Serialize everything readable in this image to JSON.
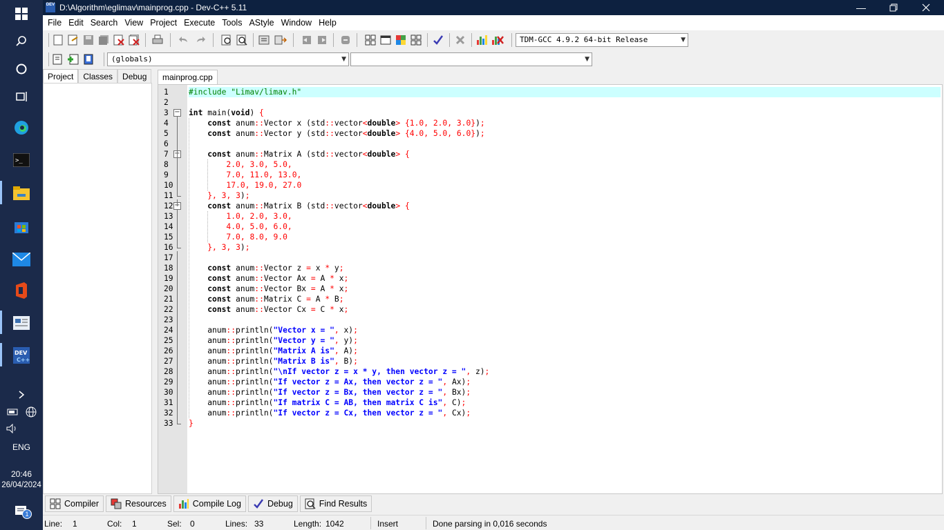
{
  "taskbar": {
    "clock_time": "20:46",
    "clock_date": "26/04/2024",
    "language": "ENG",
    "notification_count": "1"
  },
  "window": {
    "title": "D:\\Algorithm\\eglimav\\mainprog.cpp - Dev-C++ 5.11"
  },
  "menu": [
    "File",
    "Edit",
    "Search",
    "View",
    "Project",
    "Execute",
    "Tools",
    "AStyle",
    "Window",
    "Help"
  ],
  "toolbar": {
    "compiler_select": "TDM-GCC 4.9.2 64-bit Release",
    "scope_select": "(globals)",
    "function_select": ""
  },
  "left_tabs": [
    "Project",
    "Classes",
    "Debug"
  ],
  "editor": {
    "tab_label": "mainprog.cpp",
    "line_numbers": [
      "1",
      "2",
      "3",
      "4",
      "5",
      "6",
      "7",
      "8",
      "9",
      "10",
      "11",
      "12",
      "13",
      "14",
      "15",
      "16",
      "17",
      "18",
      "19",
      "20",
      "21",
      "22",
      "23",
      "24",
      "25",
      "26",
      "27",
      "28",
      "29",
      "30",
      "31",
      "32",
      "33"
    ],
    "lines": [
      "#include \"Limav/limav.h\"",
      "",
      "int main(void) {",
      "    const anum::Vector x (std::vector<double> {1.0, 2.0, 3.0});",
      "    const anum::Vector y (std::vector<double> {4.0, 5.0, 6.0});",
      "",
      "    const anum::Matrix A (std::vector<double> {",
      "        2.0, 3.0, 5.0,",
      "        7.0, 11.0, 13.0,",
      "        17.0, 19.0, 27.0",
      "    }, 3, 3);",
      "    const anum::Matrix B (std::vector<double> {",
      "        1.0, 2.0, 3.0,",
      "        4.0, 5.0, 6.0,",
      "        7.0, 8.0, 9.0",
      "    }, 3, 3);",
      "",
      "    const anum::Vector z = x * y;",
      "    const anum::Vector Ax = A * x;",
      "    const anum::Vector Bx = A * x;",
      "    const anum::Matrix C = A * B;",
      "    const anum::Vector Cx = C * x;",
      "",
      "    anum::println(\"Vector x = \", x);",
      "    anum::println(\"Vector y = \", y);",
      "    anum::println(\"Matrix A is\", A);",
      "    anum::println(\"Matrix B is\", B);",
      "    anum::println(\"\\nIf vector z = x * y, then vector z = \", z);",
      "    anum::println(\"If vector z = Ax, then vector z = \", Ax);",
      "    anum::println(\"If vector z = Bx, then vector z = \", Bx);",
      "    anum::println(\"If matrix C = AB, then matrix C is\", C);",
      "    anum::println(\"If vector z = Cx, then vector z = \", Cx);",
      "}"
    ]
  },
  "bottom_tabs": [
    "Compiler",
    "Resources",
    "Compile Log",
    "Debug",
    "Find Results"
  ],
  "status": {
    "line_label": "Line:",
    "line_value": "1",
    "col_label": "Col:",
    "col_value": "1",
    "sel_label": "Sel:",
    "sel_value": "0",
    "lines_label": "Lines:",
    "lines_value": "33",
    "length_label": "Length:",
    "length_value": "1042",
    "mode": "Insert",
    "message": "Done parsing in 0,016 seconds"
  }
}
